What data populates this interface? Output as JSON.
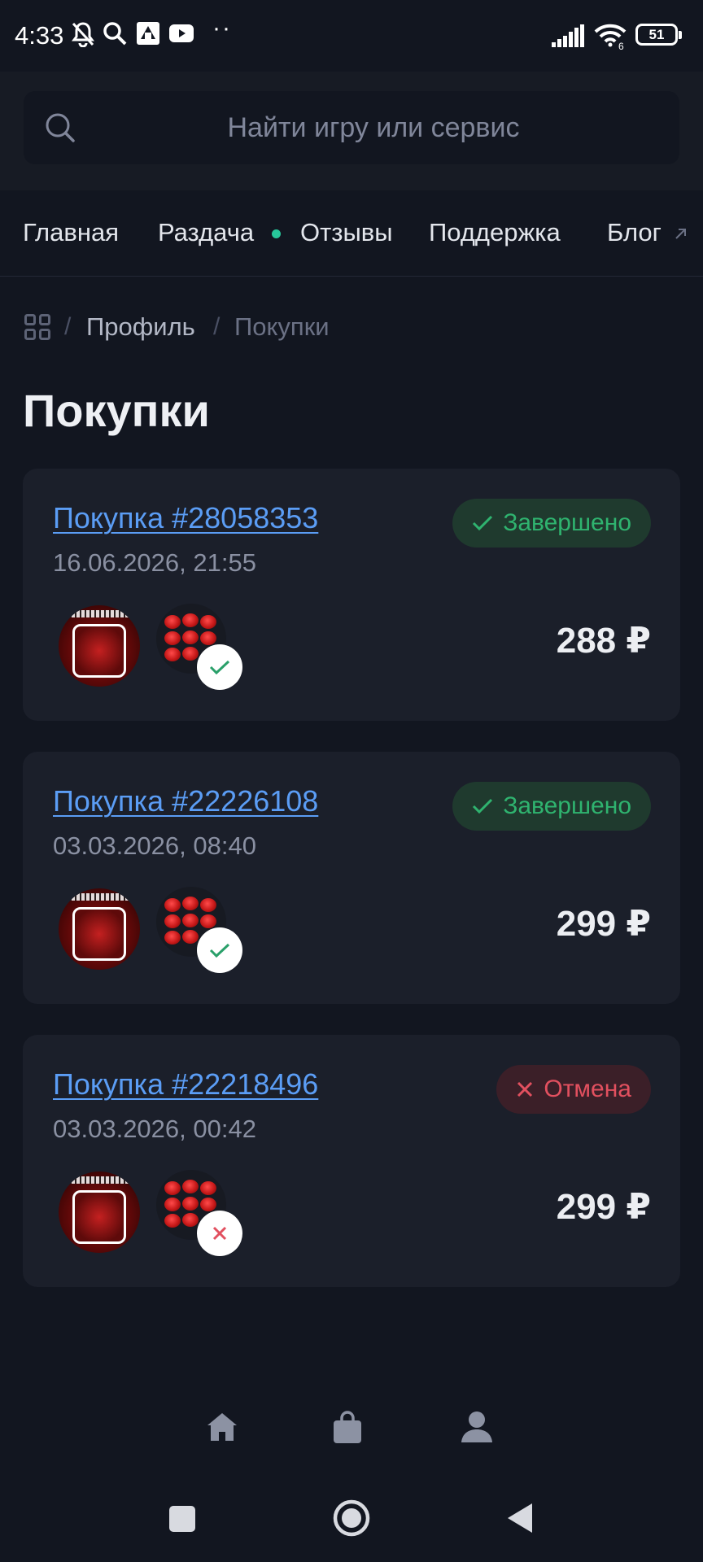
{
  "status_bar": {
    "time": "4:33",
    "battery": "51",
    "wifi_badge": "6",
    "icons": [
      "mute-bell-icon",
      "search-icon",
      "app-icon",
      "youtube-icon",
      "signal-icon",
      "wifi-icon",
      "battery-icon"
    ],
    "more": "··"
  },
  "search": {
    "placeholder": "Найти игру или сервис",
    "value": ""
  },
  "nav": {
    "items": [
      {
        "label": "Главная"
      },
      {
        "label": "Раздача"
      },
      {
        "label": "Отзывы"
      },
      {
        "label": "Поддержка"
      },
      {
        "label": "Блог"
      }
    ],
    "dot_color": "#27c79a"
  },
  "breadcrumb": {
    "sep": "/",
    "items": [
      "Профиль",
      "Покупки"
    ]
  },
  "page_title": "Покупки",
  "orders": [
    {
      "title": "Покупка #28058353",
      "date": "16.06.2026, 21:55",
      "status": "Завершено",
      "status_type": "done",
      "price": "288 ₽"
    },
    {
      "title": "Покупка #22226108",
      "date": "03.03.2026, 08:40",
      "status": "Завершено",
      "status_type": "done",
      "price": "299 ₽"
    },
    {
      "title": "Покупка #22218496",
      "date": "03.03.2026, 00:42",
      "status": "Отмена",
      "status_type": "cancel",
      "price": "299 ₽"
    }
  ],
  "colors": {
    "background": "#121620",
    "card": "#1b1f2a",
    "link": "#5b9df5",
    "success": "#2fb36f",
    "danger": "#e2505f"
  },
  "bottom_nav": [
    "home-icon",
    "shopping-bag-icon",
    "profile-icon"
  ],
  "system_nav": [
    "recents-button",
    "home-button",
    "back-button"
  ]
}
